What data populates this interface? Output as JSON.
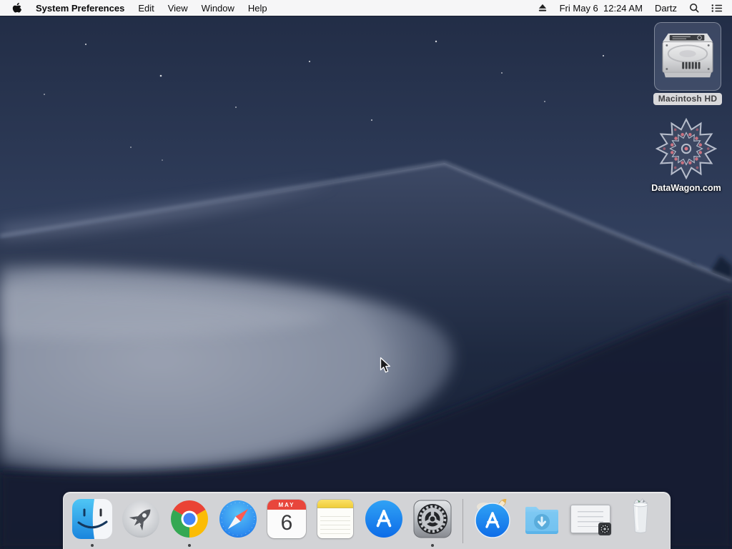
{
  "menubar": {
    "app_name": "System Preferences",
    "menus": [
      "Edit",
      "View",
      "Window",
      "Help"
    ],
    "clock": "Fri May 6  12:24 AM",
    "user": "Dartz"
  },
  "desktop": {
    "icons": [
      {
        "label": "Macintosh HD",
        "selected": true,
        "type": "hard-drive"
      },
      {
        "label": "DataWagon.com",
        "selected": false,
        "type": "web-link"
      }
    ]
  },
  "dock": {
    "items": [
      {
        "name": "finder",
        "running": true
      },
      {
        "name": "launchpad",
        "running": false
      },
      {
        "name": "google-chrome",
        "running": true
      },
      {
        "name": "safari",
        "running": false
      },
      {
        "name": "calendar",
        "running": false
      },
      {
        "name": "notes",
        "running": false
      },
      {
        "name": "app-store",
        "running": false
      },
      {
        "name": "system-preferences",
        "running": true
      },
      {
        "name": "applications-stack",
        "running": false
      },
      {
        "name": "downloads-folder",
        "running": false
      },
      {
        "name": "minimized-window",
        "running": false
      },
      {
        "name": "trash-full",
        "running": false
      }
    ]
  },
  "calendar_icon": {
    "month": "MAY",
    "day": "6"
  },
  "colors": {
    "menubar_bg": "#f6f6f7",
    "dock_bg": "#d2d3d6",
    "folder_blue": "#6fc0f0",
    "calendar_red": "#e8463c",
    "selection_pill": "#d9d9db",
    "sky_top": "#212c45",
    "dune_bright": "#9aa1b1"
  }
}
